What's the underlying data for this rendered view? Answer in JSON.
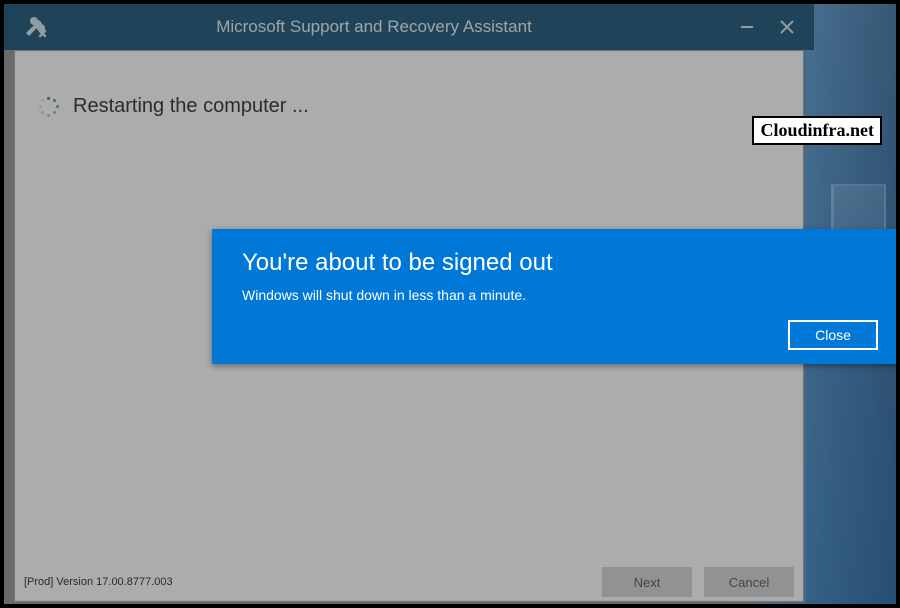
{
  "titlebar": {
    "app_title": "Microsoft Support and Recovery Assistant"
  },
  "main": {
    "status_text": "Restarting the computer ..."
  },
  "footer": {
    "version_text": "[Prod] Version 17.00.8777.003",
    "next_label": "Next",
    "cancel_label": "Cancel"
  },
  "toast": {
    "title": "You're about to be signed out",
    "message": "Windows will shut down in less than a minute.",
    "close_label": "Close"
  },
  "watermark": {
    "text": "Cloudinfra.net"
  },
  "colors": {
    "titlebar_bg": "#0b4b6f",
    "toast_bg": "#0078d7"
  }
}
